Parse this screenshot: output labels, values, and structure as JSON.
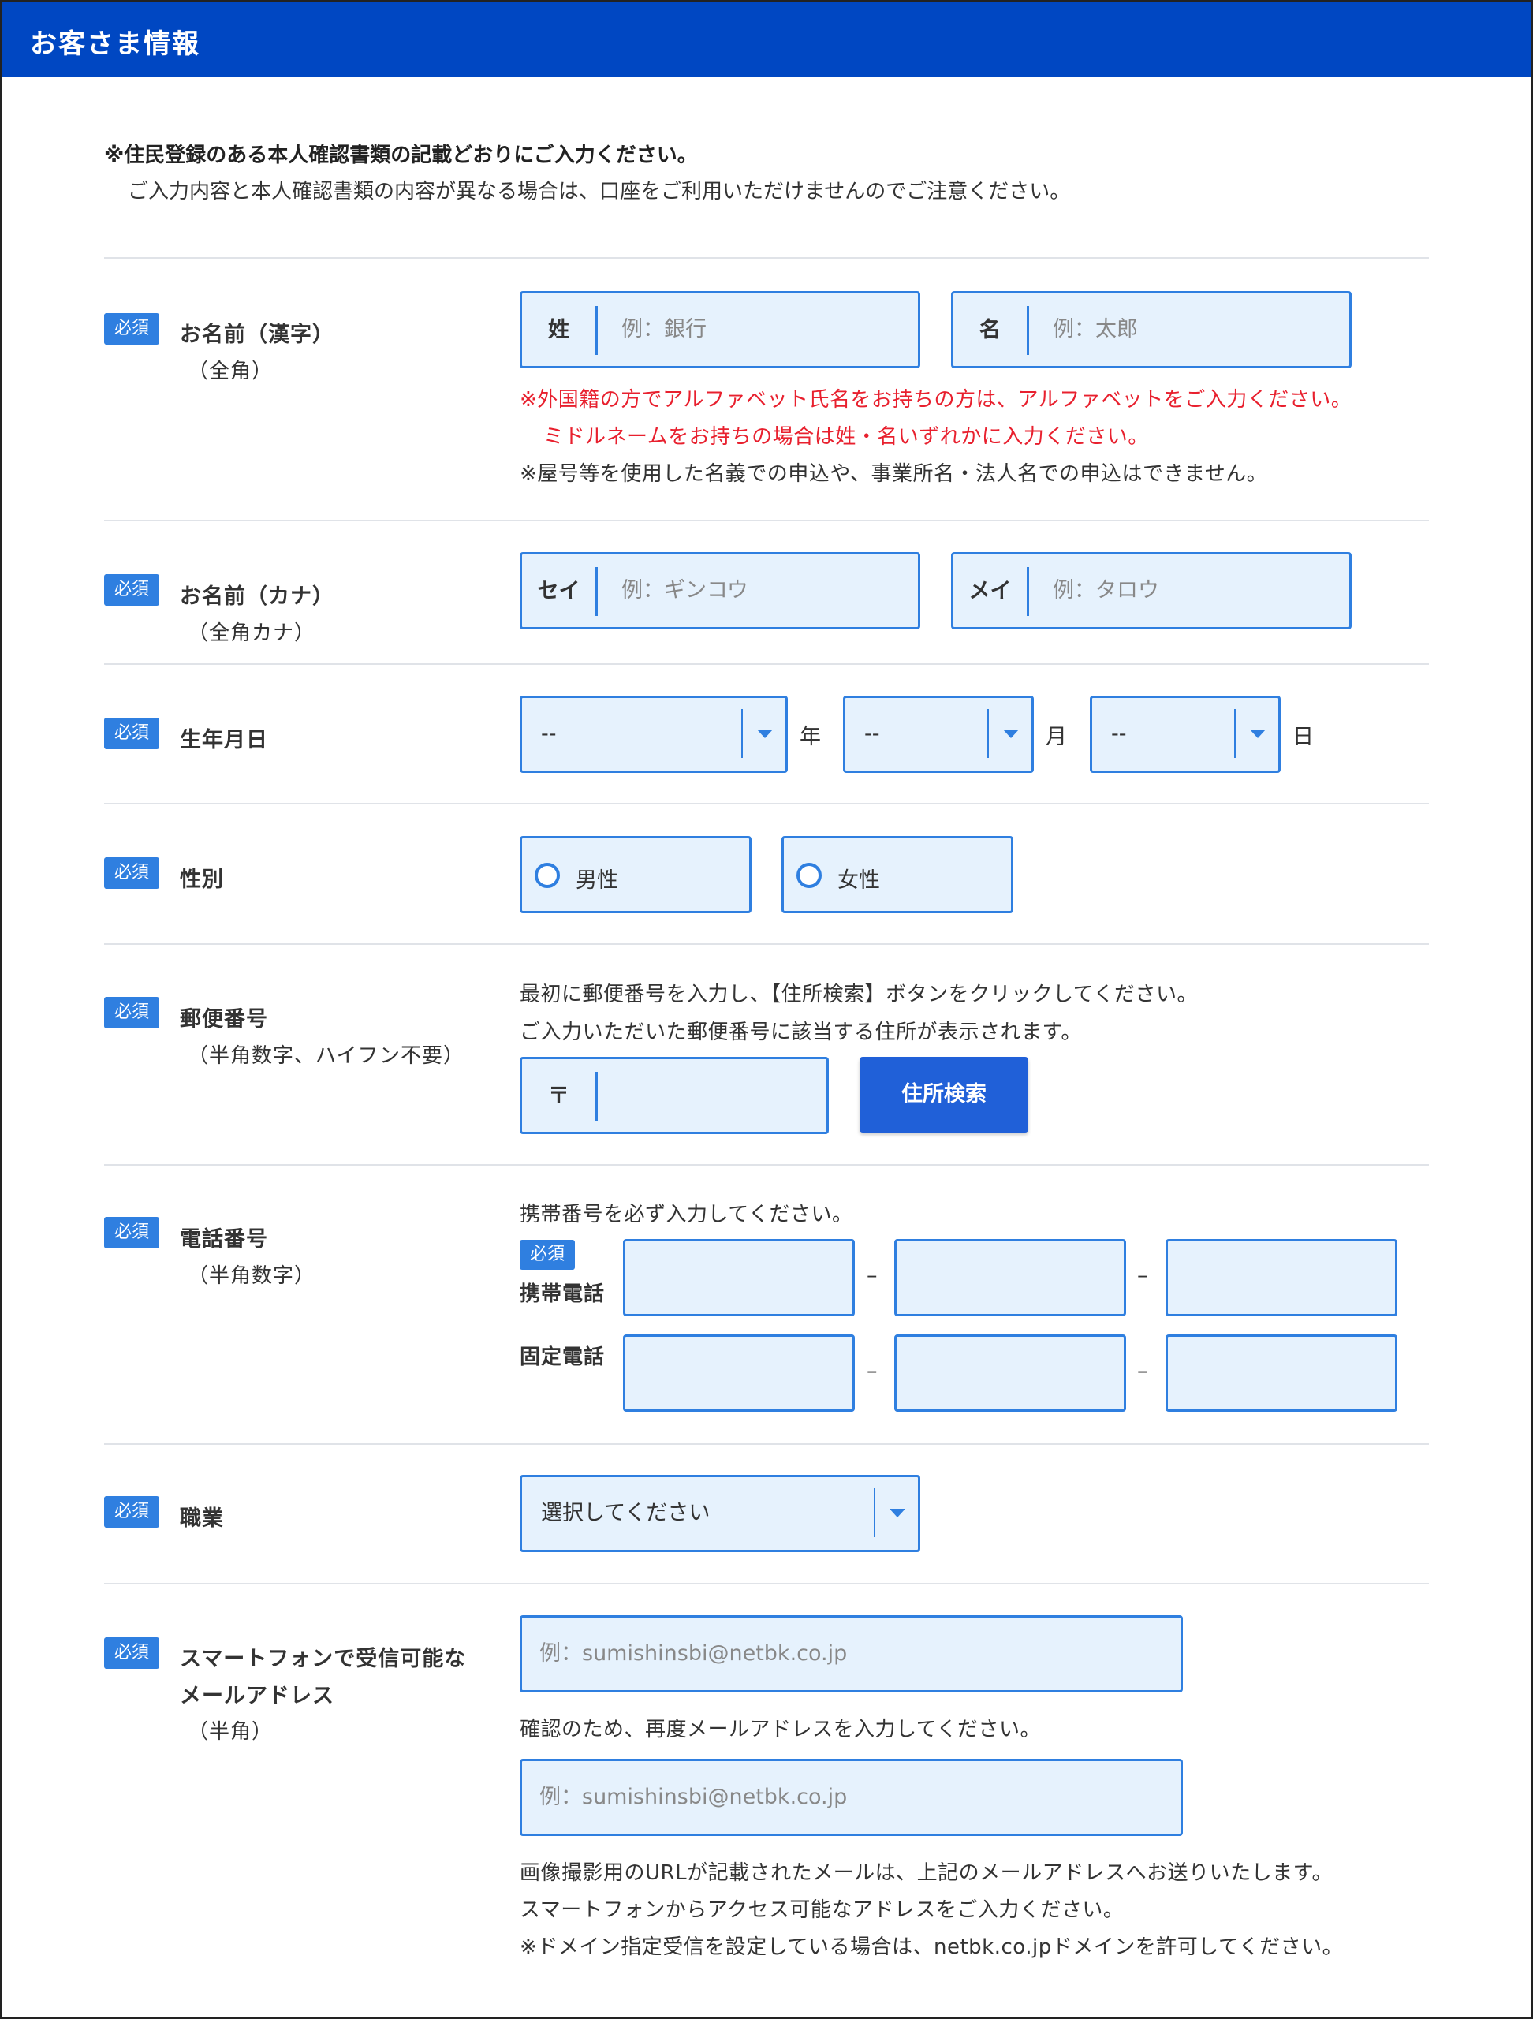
{
  "header": {
    "title": "お客さま情報"
  },
  "intro": {
    "line1": "※住民登録のある本人確認書類の記載どおりにご入力ください。",
    "line2": "ご入力内容と本人確認書類の内容が異なる場合は、口座をご利用いただけませんのでご注意ください。"
  },
  "required_label": "必須",
  "name_kanji": {
    "label": "お名前（漢字）",
    "sub": "（全角）",
    "last_prefix": "姓",
    "last_placeholder": "例：銀行",
    "first_prefix": "名",
    "first_placeholder": "例：太郎",
    "note_red1": "※外国籍の方でアルファベット氏名をお持ちの方は、アルファベットをご入力ください。",
    "note_red2": "ミドルネームをお持ちの場合は姓・名いずれかに入力ください。",
    "note": "※屋号等を使用した名義での申込や、事業所名・法人名での申込はできません。"
  },
  "name_kana": {
    "label": "お名前（カナ）",
    "sub": "（全角カナ）",
    "last_prefix": "セイ",
    "last_placeholder": "例：ギンコウ",
    "first_prefix": "メイ",
    "first_placeholder": "例：タロウ"
  },
  "birthdate": {
    "label": "生年月日",
    "year_value": "--",
    "year_unit": "年",
    "month_value": "--",
    "month_unit": "月",
    "day_value": "--",
    "day_unit": "日"
  },
  "gender": {
    "label": "性別",
    "options": [
      "男性",
      "女性"
    ]
  },
  "postal": {
    "label": "郵便番号",
    "sub": "（半角数字、ハイフン不要）",
    "help1": "最初に郵便番号を入力し、【住所検索】ボタンをクリックしてください。",
    "help2": "ご入力いただいた郵便番号に該当する住所が表示されます。",
    "prefix": "〒",
    "button": "住所検索"
  },
  "phone": {
    "label": "電話番号",
    "sub": "（半角数字）",
    "help": "携帯番号を必ず入力してください。",
    "mobile_label": "携帯電話",
    "landline_label": "固定電話",
    "dash": "–"
  },
  "occupation": {
    "label": "職業",
    "select_value": "選択してください"
  },
  "email": {
    "label_line1": "スマートフォンで受信可能な",
    "label_line2": "メールアドレス",
    "sub": "（半角）",
    "placeholder": "例：sumishinsbi@netbk.co.jp",
    "confirm_help": "確認のため、再度メールアドレスを入力してください。",
    "confirm_placeholder": "例：sumishinsbi@netbk.co.jp",
    "note1": "画像撮影用のURLが記載されたメールは、上記のメールアドレスへお送りいたします。",
    "note2": "スマートフォンからアクセス可能なアドレスをご入力ください。",
    "note3": "※ドメイン指定受信を設定している場合は、netbk.co.jpドメインを許可してください。"
  },
  "colors": {
    "header_bg": "#0047C2",
    "badge_bg": "#2F7FE0",
    "field_bg": "#E6F2FD",
    "field_border": "#2F7FE0",
    "warning_text": "#E8202E",
    "button_bg": "#2060D8"
  },
  "icons": {
    "dropdown": "caret-down-icon",
    "radio": "radio-unchecked-icon"
  }
}
